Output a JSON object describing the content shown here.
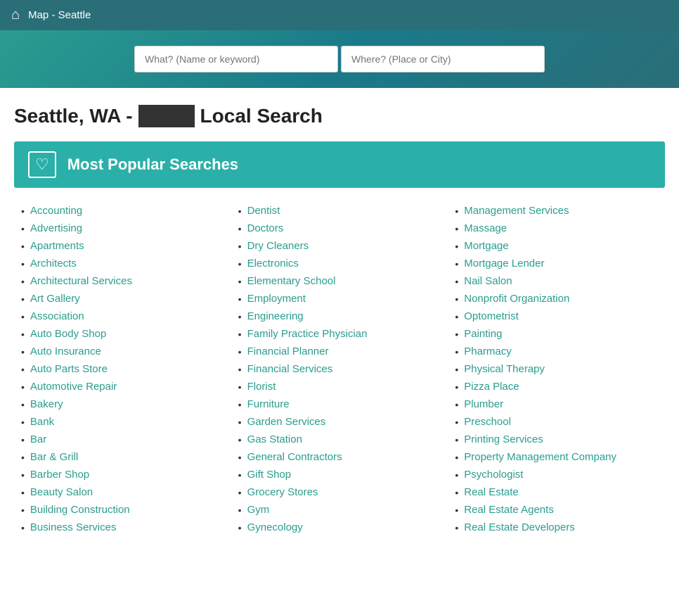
{
  "nav": {
    "title": "Map - Seattle",
    "home_icon": "⌂"
  },
  "search": {
    "what_placeholder": "What? (Name or keyword)",
    "where_placeholder": "Where? (Place or City)"
  },
  "heading": {
    "prefix": "Seattle, WA -",
    "suffix": "Local Search"
  },
  "popular": {
    "icon": "♡",
    "title": "Most Popular Searches"
  },
  "columns": [
    {
      "items": [
        "Accounting",
        "Advertising",
        "Apartments",
        "Architects",
        "Architectural Services",
        "Art Gallery",
        "Association",
        "Auto Body Shop",
        "Auto Insurance",
        "Auto Parts Store",
        "Automotive Repair",
        "Bakery",
        "Bank",
        "Bar",
        "Bar & Grill",
        "Barber Shop",
        "Beauty Salon",
        "Building Construction",
        "Business Services"
      ]
    },
    {
      "items": [
        "Dentist",
        "Doctors",
        "Dry Cleaners",
        "Electronics",
        "Elementary School",
        "Employment",
        "Engineering",
        "Family Practice Physician",
        "Financial Planner",
        "Financial Services",
        "Florist",
        "Furniture",
        "Garden Services",
        "Gas Station",
        "General Contractors",
        "Gift Shop",
        "Grocery Stores",
        "Gym",
        "Gynecology"
      ]
    },
    {
      "items": [
        "Management Services",
        "Massage",
        "Mortgage",
        "Mortgage Lender",
        "Nail Salon",
        "Nonprofit Organization",
        "Optometrist",
        "Painting",
        "Pharmacy",
        "Physical Therapy",
        "Pizza Place",
        "Plumber",
        "Preschool",
        "Printing Services",
        "Property Management Company",
        "Psychologist",
        "Real Estate",
        "Real Estate Agents",
        "Real Estate Developers"
      ]
    }
  ]
}
